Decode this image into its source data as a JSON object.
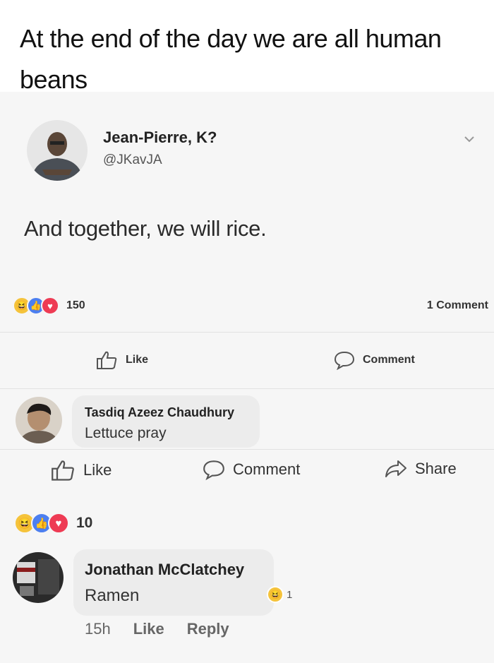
{
  "caption": "At the end of the day we are all human beans",
  "post": {
    "author_name": "Jean-Pierre, K?",
    "handle": "@JKavJA",
    "text": "And together, we will rice.",
    "reaction_count": "150",
    "comments_count": "1 Comment",
    "like_label": "Like",
    "comment_label": "Comment"
  },
  "comment1": {
    "author_name": "Tasdiq Azeez Chaudhury",
    "text": "Lettuce pray",
    "like_label": "Like",
    "comment_label": "Comment",
    "share_label": "Share",
    "reaction_count": "10"
  },
  "comment2": {
    "author_name": "Jonathan McClatchey",
    "text": "Ramen",
    "mini_reaction_count": "1",
    "time": "15h",
    "like_label": "Like",
    "reply_label": "Reply"
  },
  "icons": {
    "reaction_types": [
      "haha",
      "like",
      "love"
    ],
    "colors": {
      "haha": "#f5c33b",
      "like": "#4c7ff0",
      "love": "#ee3b54"
    }
  }
}
